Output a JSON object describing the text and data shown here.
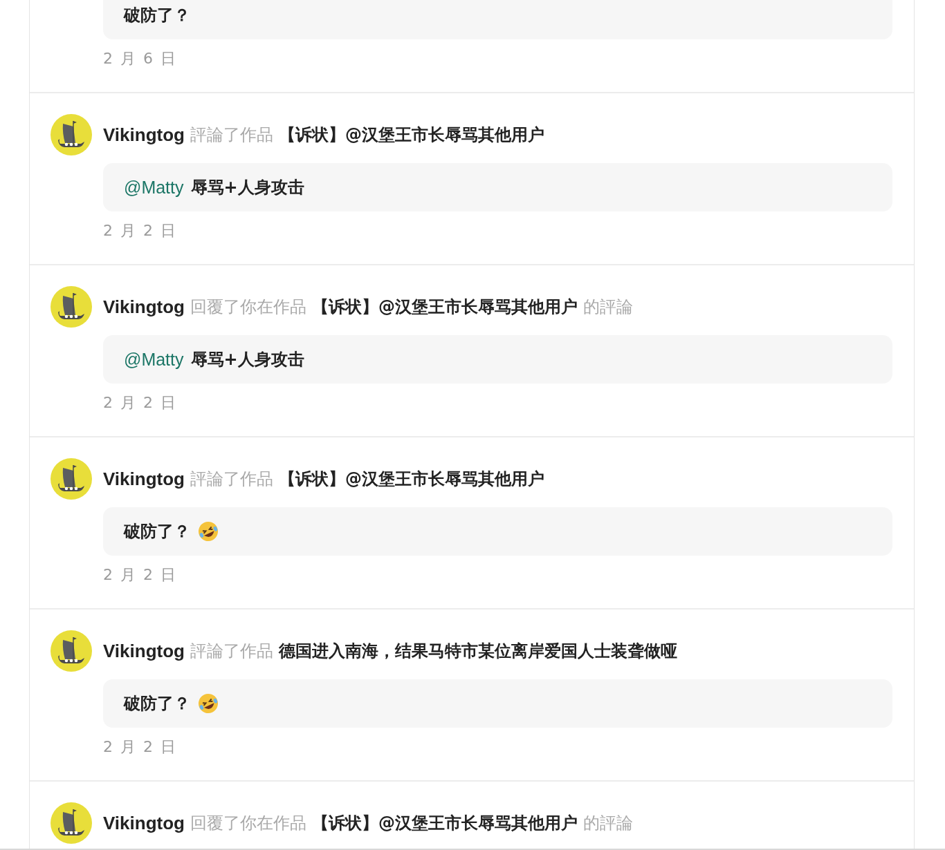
{
  "notifications": [
    {
      "message": {
        "text": "破防了？",
        "emoji": false
      },
      "date": "2 月 6 日"
    },
    {
      "user": "Vikingtog",
      "action": "評論了作品",
      "work": "【诉状】@汉堡王市长辱骂其他用户",
      "message": {
        "mention": "@Matty",
        "text": "辱骂+人身攻击",
        "emoji": false
      },
      "date": "2 月 2 日"
    },
    {
      "user": "Vikingtog",
      "action": "回覆了你在作品",
      "work": "【诉状】@汉堡王市长辱骂其他用户",
      "suffix": "的評論",
      "message": {
        "mention": "@Matty",
        "text": "辱骂+人身攻击",
        "emoji": false
      },
      "date": "2 月 2 日"
    },
    {
      "user": "Vikingtog",
      "action": "評論了作品",
      "work": "【诉状】@汉堡王市长辱骂其他用户",
      "message": {
        "text": "破防了？",
        "emoji": true
      },
      "date": "2 月 2 日"
    },
    {
      "user": "Vikingtog",
      "action": "評論了作品",
      "work": "德国进入南海，结果马特市某位离岸爱国人士装聋做哑",
      "message": {
        "text": "破防了？",
        "emoji": true
      },
      "date": "2 月 2 日"
    },
    {
      "user": "Vikingtog",
      "action": "回覆了你在作品",
      "work": "【诉状】@汉堡王市长辱骂其他用户",
      "suffix": "的評論"
    }
  ]
}
